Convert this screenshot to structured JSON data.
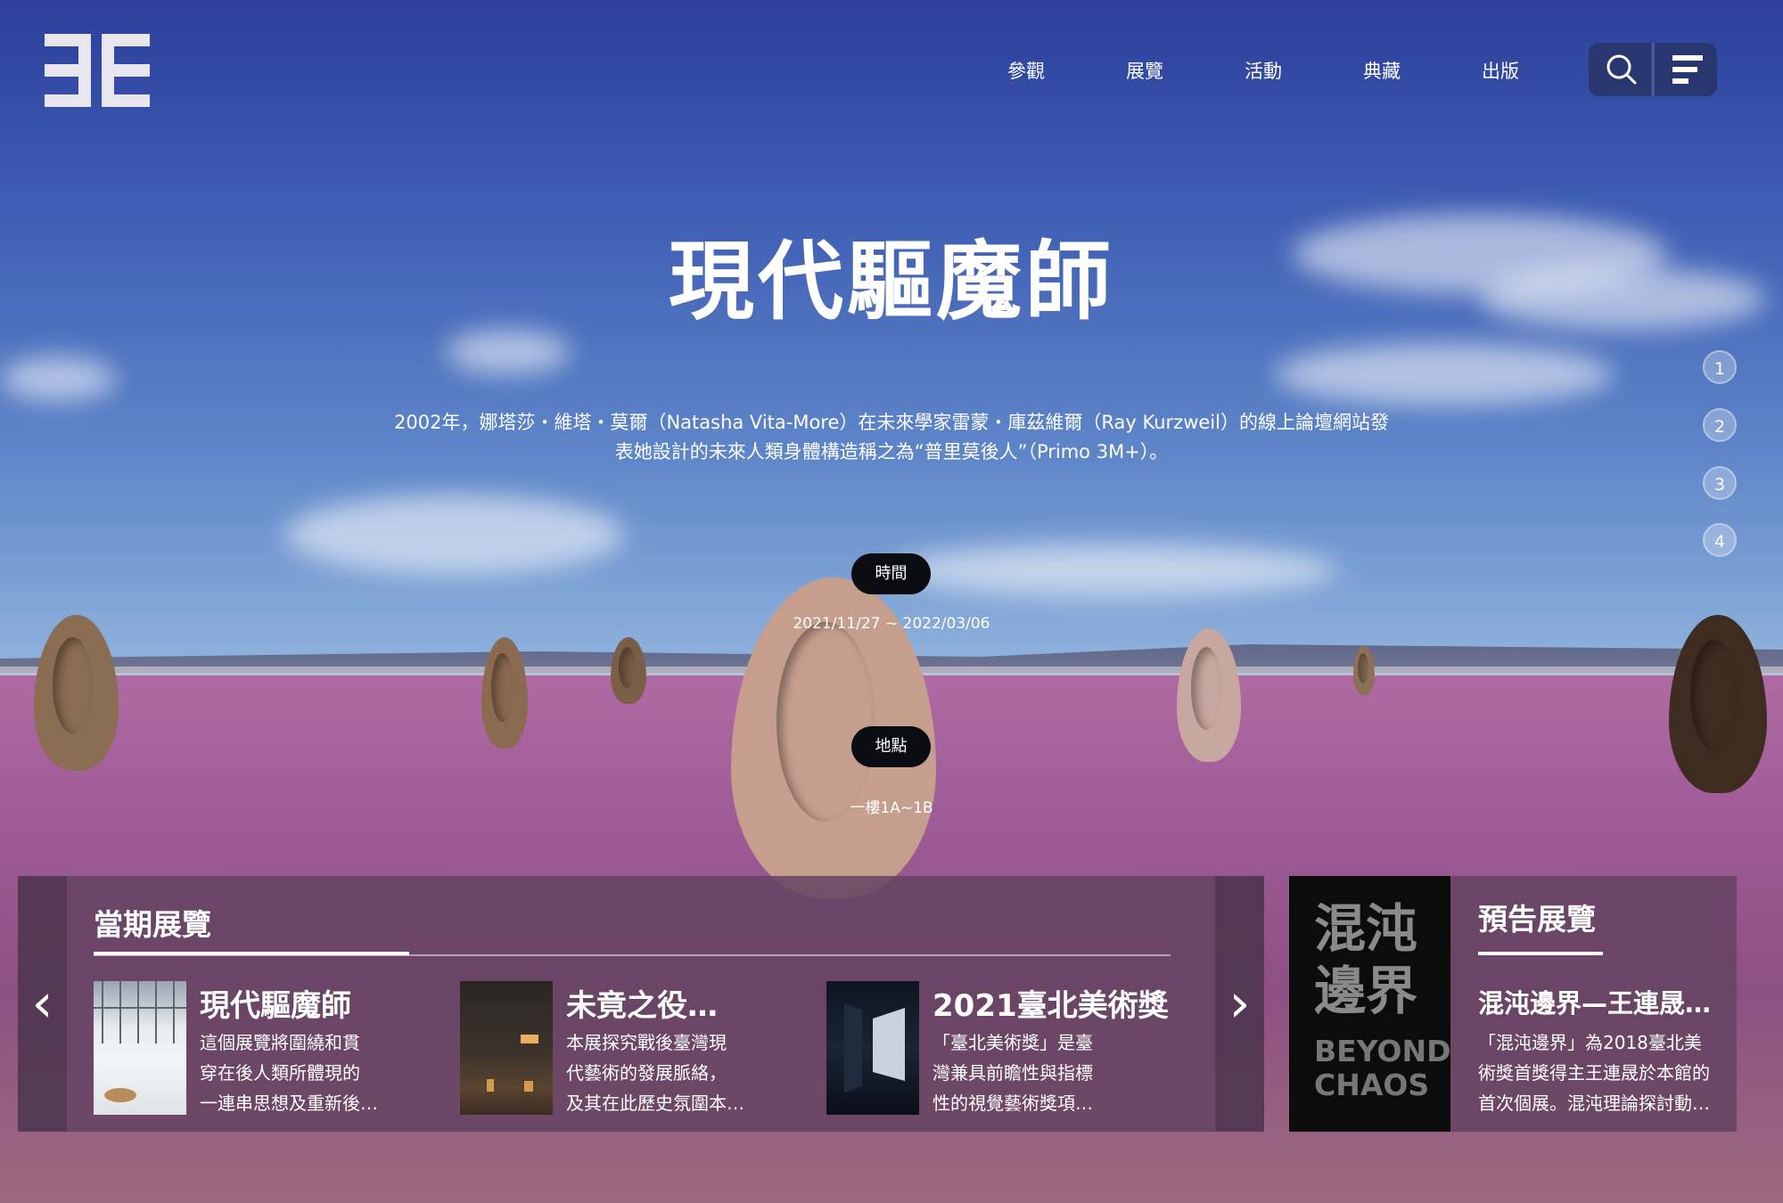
{
  "header": {
    "logo_icon": "museum-logo",
    "nav": [
      "參觀",
      "展覽",
      "活動",
      "典藏",
      "出版"
    ],
    "search_icon": "search-icon",
    "menu_icon": "menu-icon"
  },
  "hero": {
    "title": "現代驅魔師",
    "description_line1": "2002年，娜塔莎・維塔・莫爾（Natasha Vita-More）在未來學家雷蒙・庫茲維爾（Ray Kurzweil）的線上論壇網站發",
    "description_line2": "表她設計的未來人類身體構造稱之為“普里莫後人”（Primo 3M+）。",
    "time_label": "時間",
    "time_value": "2021/11/27 ~ 2022/03/06",
    "place_label": "地點",
    "place_value": "一樓1A~1B",
    "pager": [
      "1",
      "2",
      "3",
      "4"
    ]
  },
  "current": {
    "title": "當期展覽",
    "prev_icon": "chevron-left-icon",
    "next_icon": "chevron-right-icon",
    "cards": [
      {
        "title": "現代驅魔師",
        "desc": [
          "這個展覽將圍繞和貫",
          "穿在後人類所體現的",
          "一連串思想及重新後…"
        ]
      },
      {
        "title": "未竟之役…",
        "desc": [
          "本展探究戰後臺灣現",
          "代藝術的發展脈絡，",
          "及其在此歷史氛圍本…"
        ]
      },
      {
        "title": "2021臺北美術獎",
        "desc": [
          "「臺北美術獎」是臺",
          "灣兼具前瞻性與指標",
          "性的視覺藝術獎項…"
        ]
      }
    ]
  },
  "upcoming": {
    "title": "預告展覽",
    "poster_zh": [
      "混沌",
      "邊界"
    ],
    "poster_en": [
      "BEYOND",
      "CHAOS"
    ],
    "card_title": "混沌邊界—王連晟…",
    "card_desc": [
      "「混沌邊界」為2018臺北美",
      "術獎首獎得主王連晟於本館的",
      "首次個展。混沌理論探討動…"
    ]
  },
  "colors": {
    "panel": "#654362",
    "tool": "#28376f",
    "pill": "#0b0b12"
  }
}
